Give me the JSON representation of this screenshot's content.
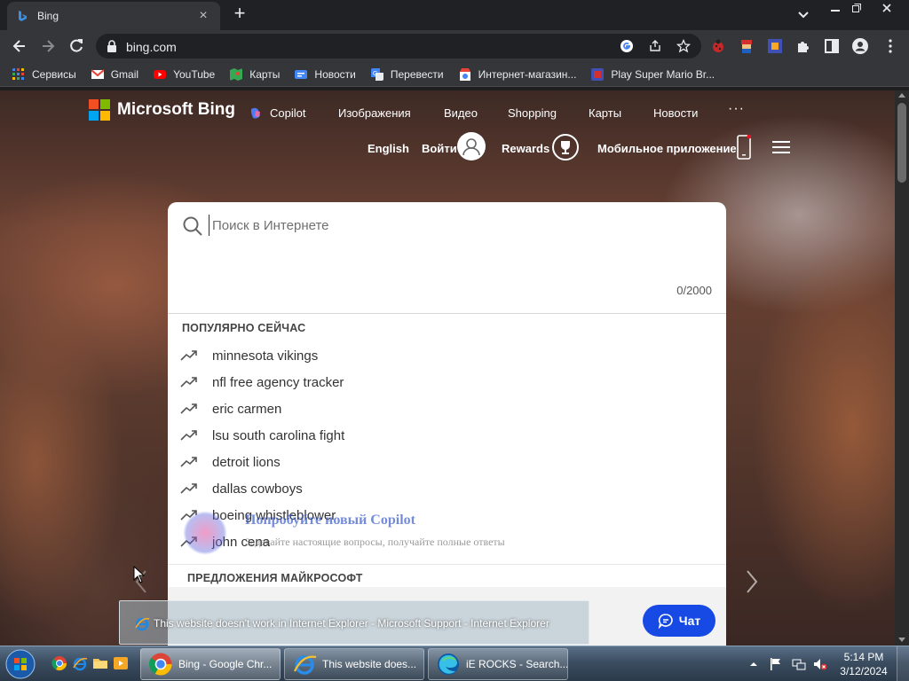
{
  "browser": {
    "tab_title": "Bing",
    "url": "bing.com"
  },
  "bookmarks": [
    {
      "label": "Сервисы",
      "icon": "apps-grid-icon"
    },
    {
      "label": "Gmail",
      "icon": "gmail-icon"
    },
    {
      "label": "YouTube",
      "icon": "youtube-icon"
    },
    {
      "label": "Карты",
      "icon": "maps-icon"
    },
    {
      "label": "Новости",
      "icon": "news-icon"
    },
    {
      "label": "Перевести",
      "icon": "translate-icon"
    },
    {
      "label": "Интернет-магазин...",
      "icon": "web-store-icon"
    },
    {
      "label": "Play Super Mario Br...",
      "icon": "mario-icon"
    }
  ],
  "bing": {
    "logo_text": "Microsoft Bing",
    "nav": [
      "Copilot",
      "Изображения",
      "Видео",
      "Shopping",
      "Карты",
      "Новости",
      "···"
    ],
    "language": "English",
    "sign_in": "Войти",
    "rewards": "Rewards",
    "mobile_app": "Мобильное приложение",
    "search_placeholder": "Поиск в Интернете",
    "char_counter": "0/2000",
    "trending_title": "ПОПУЛЯРНО СЕЙЧАС",
    "trending": [
      "minnesota vikings",
      "nfl free agency tracker",
      "eric carmen",
      "lsu south carolina fight",
      "detroit lions",
      "dallas cowboys",
      "boeing whistleblower",
      "john cena"
    ],
    "ms_suggestions_title": "ПРЕДЛОЖЕНИЯ МАЙКРОСОФТ",
    "promo_title": "Попробуйте новый Copilot",
    "promo_subtitle": "Задавайте настоящие вопросы, получайте полные ответы",
    "chat_label": "Чат"
  },
  "tooltip": {
    "text": "This website doesn't work in Internet Explorer - Microsoft Support - Internet Explorer"
  },
  "taskbar": {
    "buttons": [
      {
        "label": "Bing - Google Chr...",
        "icon": "chrome-icon"
      },
      {
        "label": "This website does...",
        "icon": "internet-explorer-icon"
      },
      {
        "label": "iE ROCKS - Search...",
        "icon": "edge-icon"
      }
    ],
    "time": "5:14 PM",
    "date": "3/12/2024"
  },
  "colors": {
    "bing_blue": "#174ae4",
    "chrome_dark": "#35363a",
    "accent_red": "#ea4335"
  }
}
